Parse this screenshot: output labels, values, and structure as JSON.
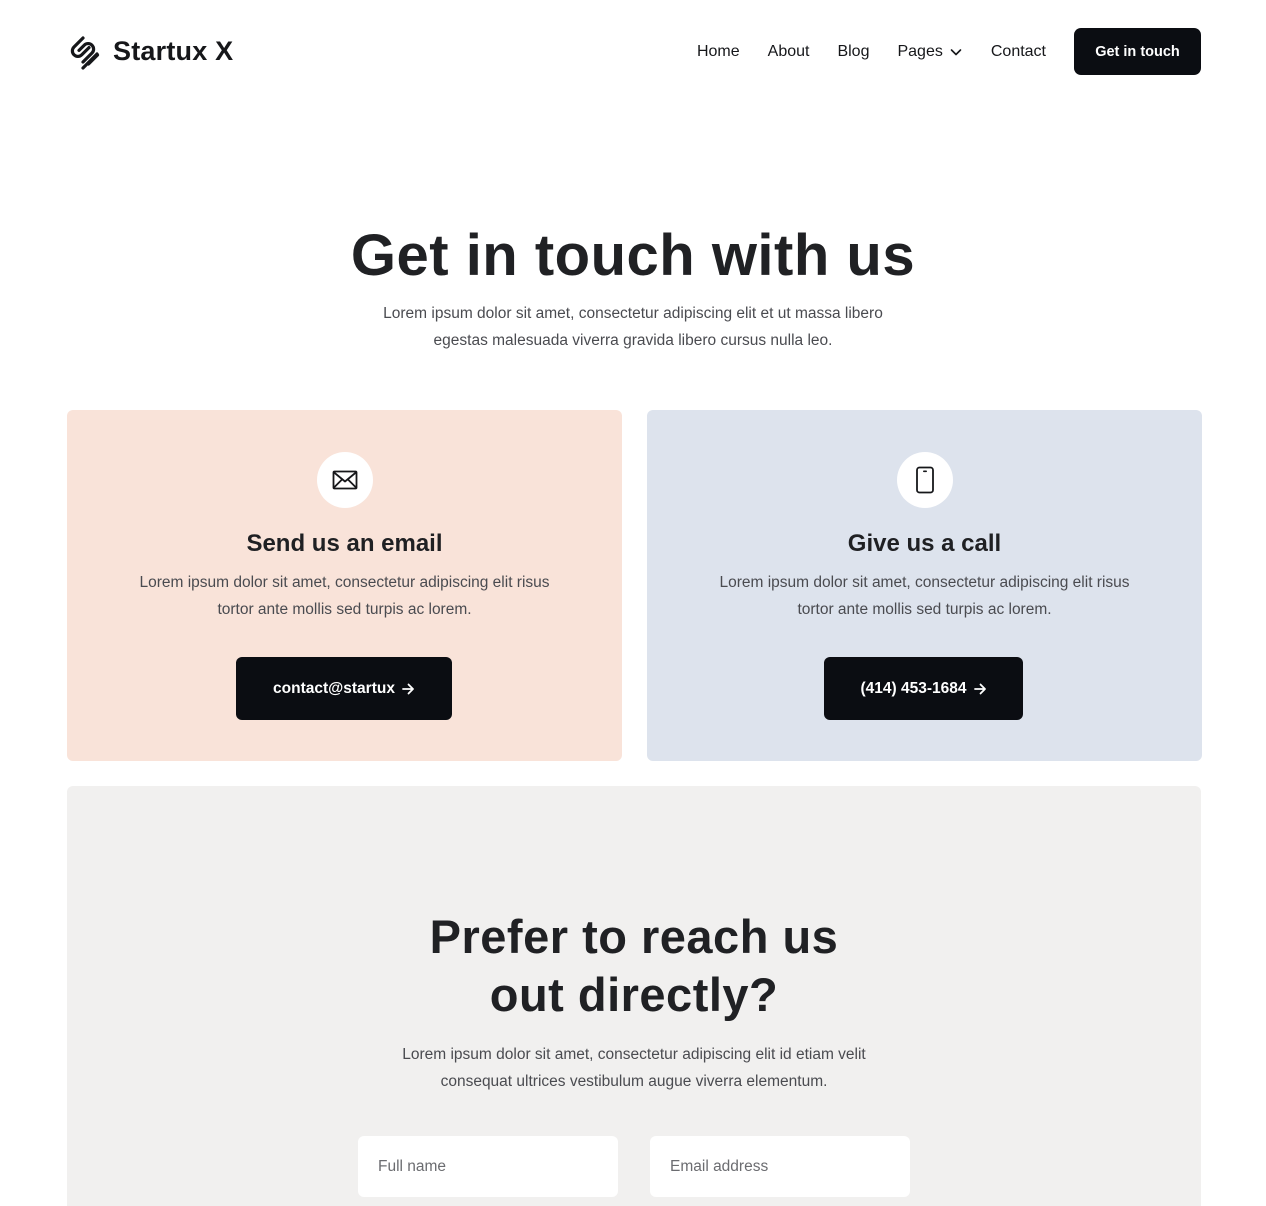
{
  "brand": {
    "name": "Startux X",
    "logo_icon": "link-chain-logo-icon"
  },
  "nav": {
    "items": [
      {
        "label": "Home"
      },
      {
        "label": "About"
      },
      {
        "label": "Blog"
      },
      {
        "label": "Pages",
        "icon": "chevron-down-icon"
      },
      {
        "label": "Contact"
      }
    ],
    "cta_label": "Get in touch"
  },
  "hero": {
    "title": "Get in touch with us",
    "subtitle": "Lorem ipsum dolor sit amet, consectetur adipiscing elit et ut massa libero egestas malesuada viverra gravida libero cursus nulla leo."
  },
  "cards": [
    {
      "icon": "envelope-icon",
      "title": "Send us an email",
      "description": "Lorem ipsum dolor sit amet, consectetur adipiscing elit risus tortor ante mollis sed turpis ac lorem.",
      "button_label": "contact@startux",
      "background": "#f9e3d9"
    },
    {
      "icon": "phone-icon",
      "title": "Give us a call",
      "description": "Lorem ipsum dolor sit amet, consectetur adipiscing elit risus tortor ante mollis sed turpis ac lorem.",
      "button_label": "(414) 453-1684",
      "background": "#dde3ed"
    }
  ],
  "direct": {
    "title_line1": "Prefer to reach us",
    "title_line2": "out directly?",
    "subtitle": "Lorem ipsum dolor sit amet, consectetur adipiscing elit id etiam velit consequat ultrices vestibulum augue viverra elementum.",
    "full_name_placeholder": "Full name",
    "email_placeholder": "Email address",
    "background": "#f1f0ef"
  },
  "colors": {
    "button_dark": "#0b0d12",
    "text_dark": "#202124",
    "text_muted": "#4a4b50"
  }
}
